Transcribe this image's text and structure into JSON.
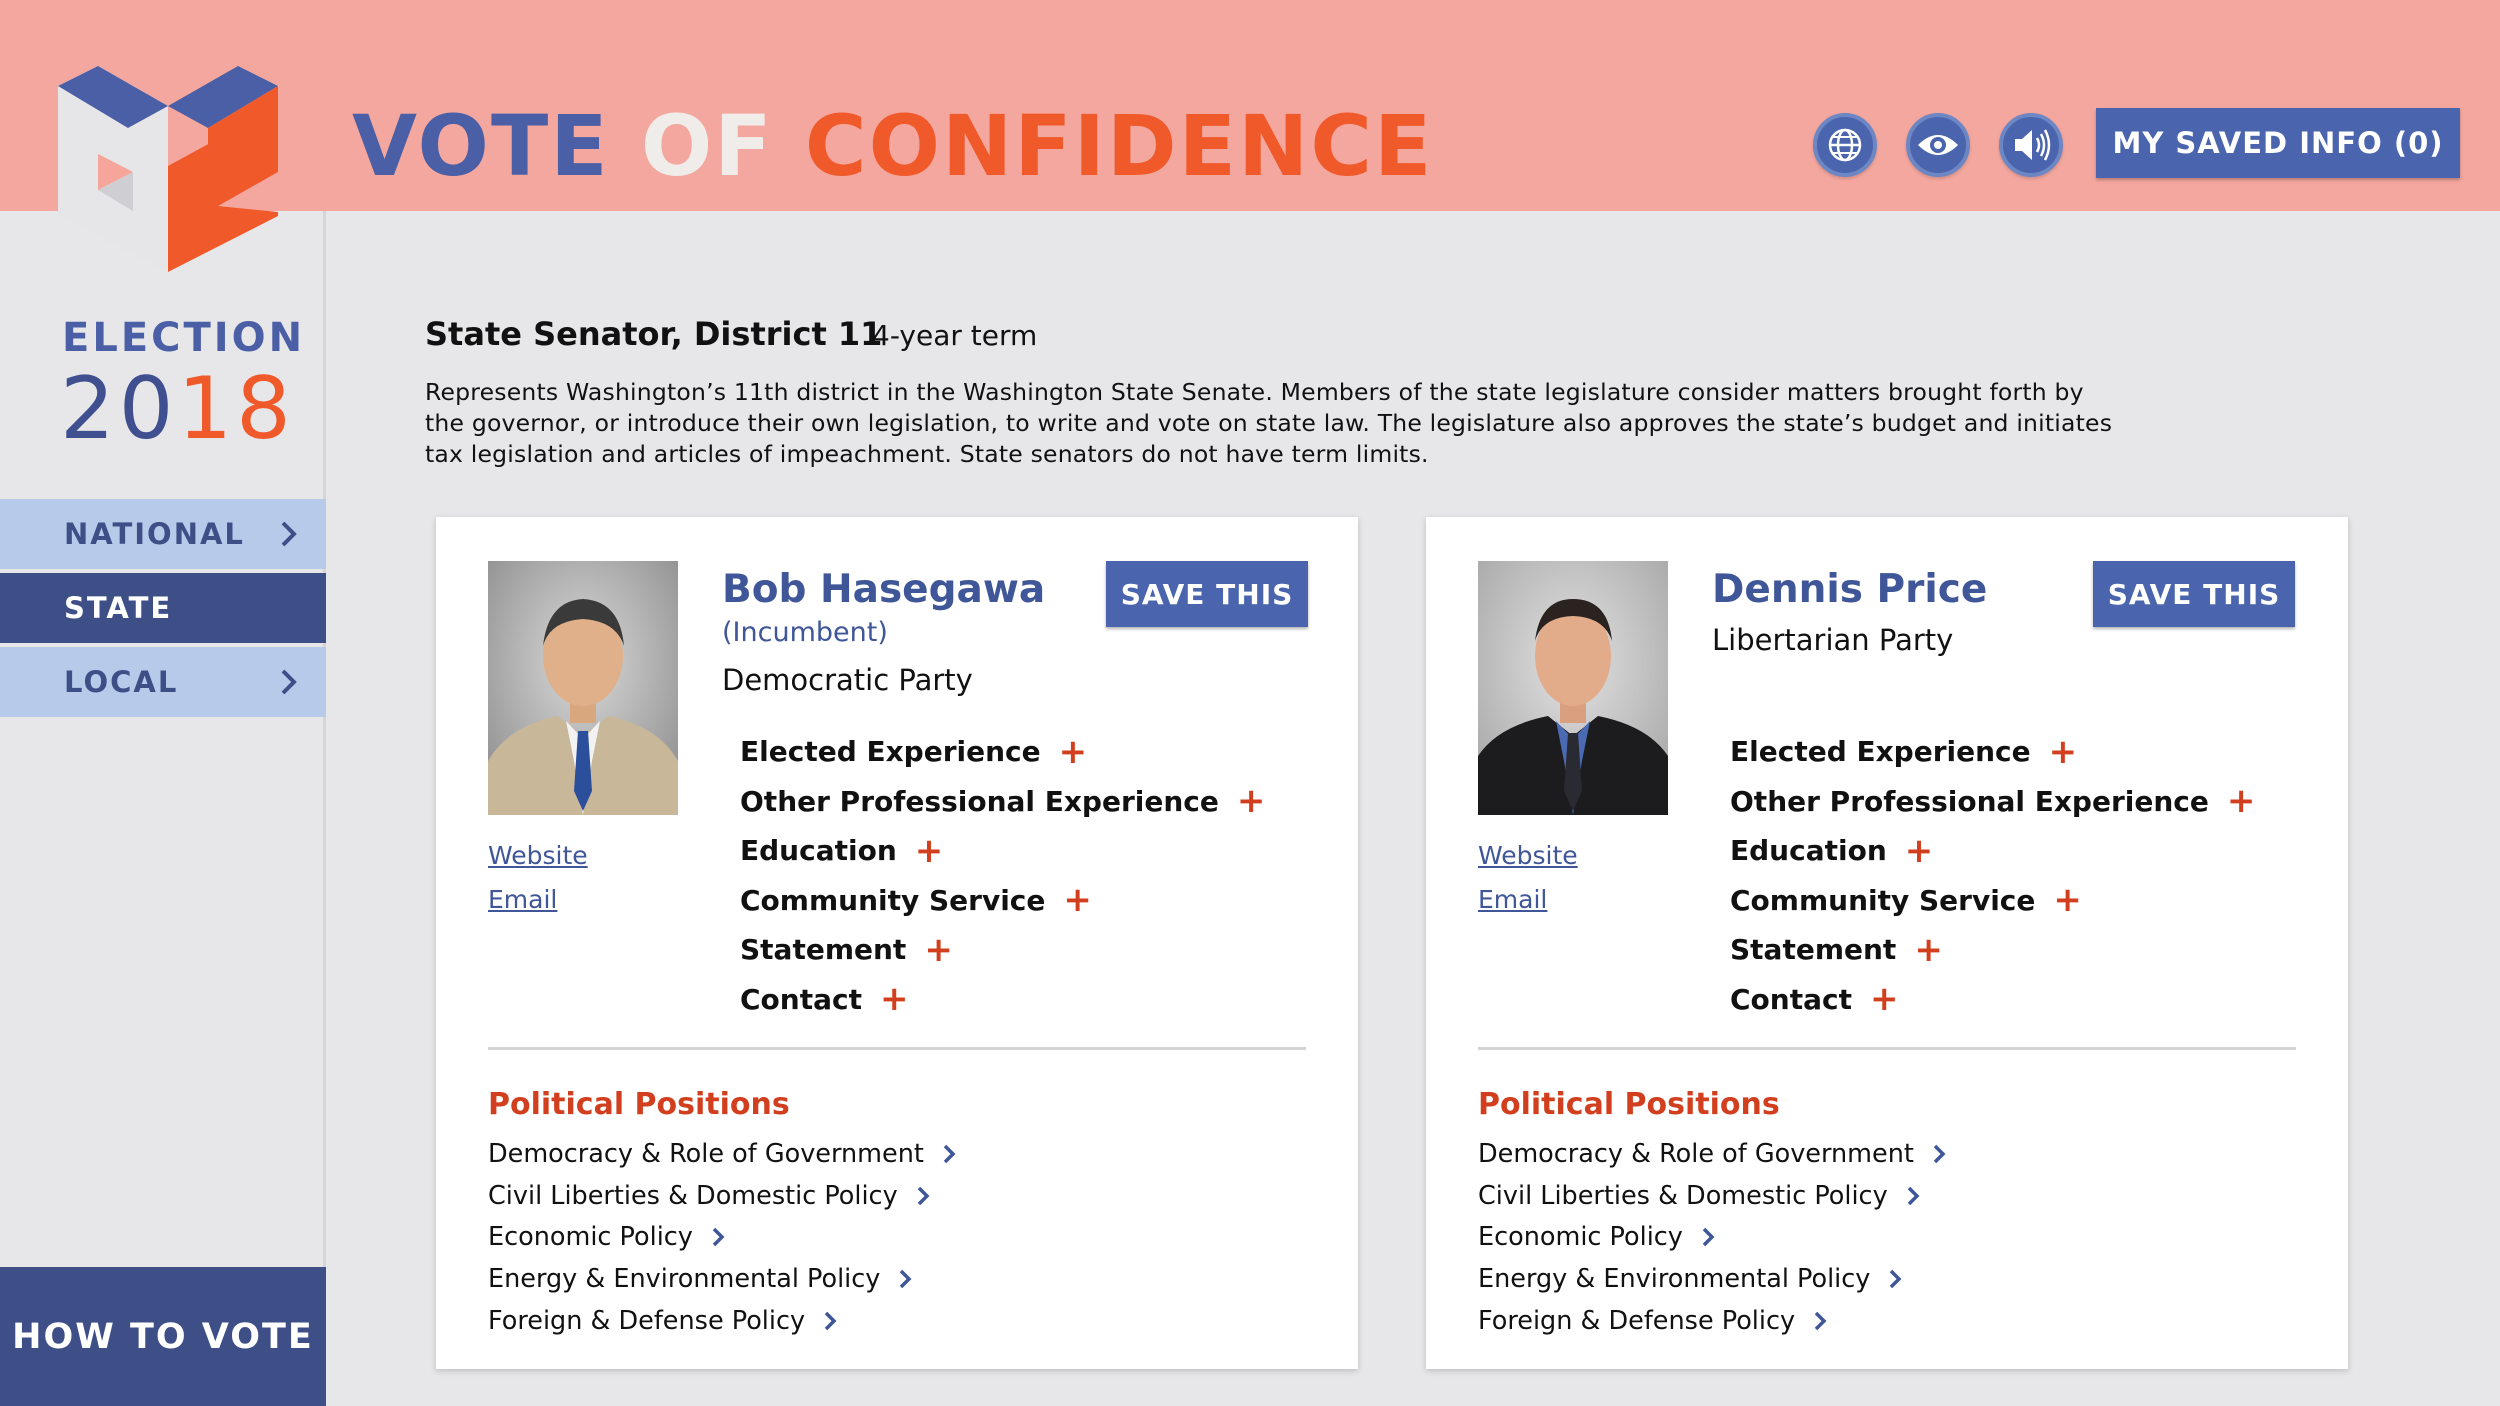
{
  "app": {
    "title_part1": "VOTE",
    "title_part2": "OF",
    "title_part3": "CONFIDENCE",
    "colors": {
      "header_bg": "#f4a79e",
      "brand_blue": "#4a65ad",
      "brand_orange": "#f05a2b",
      "nav_active": "#3e4f88",
      "nav_inactive": "#b7caea"
    }
  },
  "header": {
    "icons": [
      "globe-icon",
      "eye-icon",
      "speaker-icon"
    ],
    "saved_button": "MY SAVED INFO (0)"
  },
  "sidebar": {
    "election_label": "ELECTION",
    "year_part1": "20",
    "year_part2": "18",
    "nav": [
      {
        "label": "NATIONAL",
        "active": false
      },
      {
        "label": "STATE",
        "active": true
      },
      {
        "label": "LOCAL",
        "active": false
      }
    ],
    "how_to_vote": "HOW TO VOTE"
  },
  "office": {
    "title": "State Senator, District 11",
    "term": "4-year term",
    "description": "Represents Washington’s 11th district in the Washington State Senate.  Members of the state legislature consider matters brought forth by the governor, or introduce their own legislation, to write and vote on state law. The legislature also approves the state’s budget and initiates tax legislation and articles of impeachment. State senators do not have term limits."
  },
  "candidates": [
    {
      "name": "Bob Hasegawa",
      "note": "(Incumbent)",
      "party": "Democratic Party",
      "save_label": "SAVE THIS",
      "website_label": "Website",
      "email_label": "Email",
      "experience": [
        "Elected Experience",
        "Other Professional Experience",
        "Education",
        "Community Service",
        "Statement",
        "Contact"
      ],
      "positions_heading": "Political Positions",
      "positions": [
        "Democracy & Role of Government",
        "Civil Liberties & Domestic Policy",
        "Economic Policy",
        "Energy & Environmental Policy",
        "Foreign & Defense Policy"
      ]
    },
    {
      "name": "Dennis Price",
      "note": "",
      "party": "Libertarian Party",
      "save_label": "SAVE THIS",
      "website_label": "Website",
      "email_label": "Email",
      "experience": [
        "Elected Experience",
        "Other Professional Experience",
        "Education",
        "Community Service",
        "Statement",
        "Contact"
      ],
      "positions_heading": "Political Positions",
      "positions": [
        "Democracy & Role of Government",
        "Civil Liberties & Domestic Policy",
        "Economic Policy",
        "Energy & Environmental Policy",
        "Foreign & Defense Policy"
      ]
    }
  ]
}
